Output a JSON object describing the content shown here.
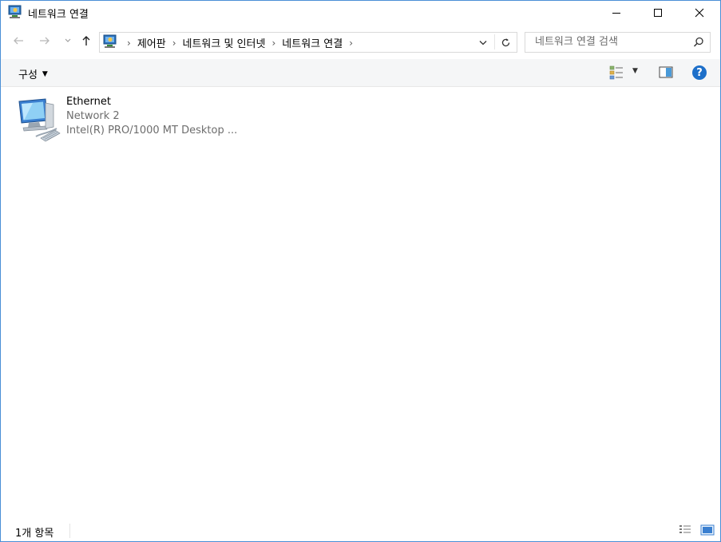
{
  "window": {
    "title": "네트워크 연결",
    "icon": "network-connections-icon",
    "accent_color": "#4a8fd6"
  },
  "address": {
    "breadcrumbs": [
      "제어판",
      "네트워크 및 인터넷",
      "네트워크 연결"
    ]
  },
  "search": {
    "placeholder": "네트워크 연결 검색"
  },
  "toolbar": {
    "organize_label": "구성",
    "help_label": "?"
  },
  "items": [
    {
      "name": "Ethernet",
      "network": "Network  2",
      "adapter": "Intel(R) PRO/1000 MT Desktop ..."
    }
  ],
  "status": {
    "count": "1개 항목"
  }
}
